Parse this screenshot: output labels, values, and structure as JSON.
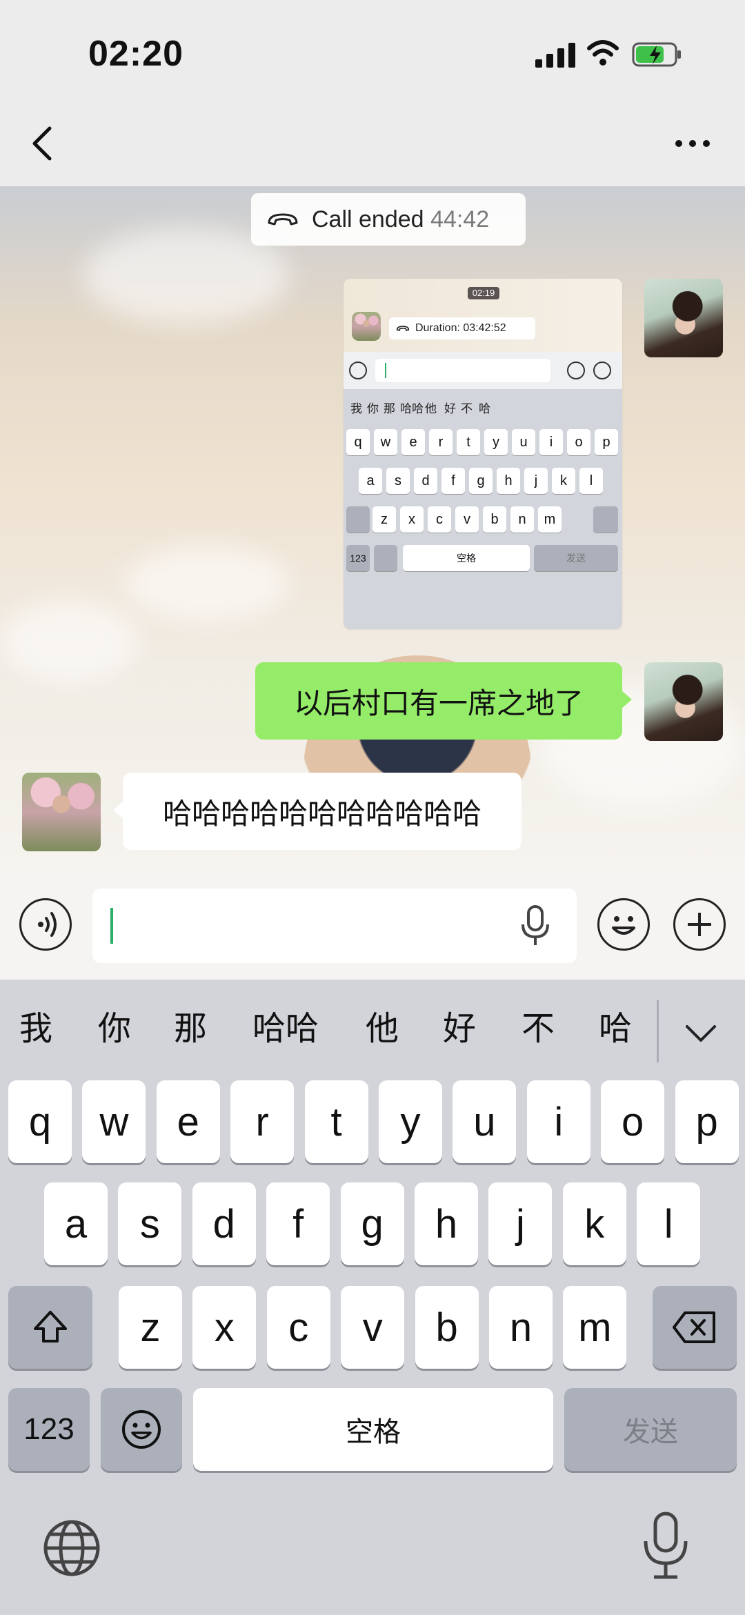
{
  "status_bar": {
    "time": "02:20"
  },
  "chat": {
    "call_label": "Call ended",
    "call_duration": "44:42",
    "messages": [
      {
        "from": "me",
        "type": "image"
      },
      {
        "from": "me",
        "type": "text",
        "text": "以后村口有一席之地了"
      },
      {
        "from": "other",
        "type": "text",
        "text": "哈哈哈哈哈哈哈哈哈哈哈"
      }
    ],
    "screenshot": {
      "time": "02:19",
      "call_text": "Duration: 03:42:52",
      "candidates": [
        "我",
        "你",
        "那",
        "哈哈",
        "他",
        "好",
        "不",
        "哈"
      ],
      "row1": [
        "q",
        "w",
        "e",
        "r",
        "t",
        "y",
        "u",
        "i",
        "o",
        "p"
      ],
      "row2": [
        "a",
        "s",
        "d",
        "f",
        "g",
        "h",
        "j",
        "k",
        "l"
      ],
      "row3": [
        "z",
        "x",
        "c",
        "v",
        "b",
        "n",
        "m"
      ],
      "num_label": "123",
      "space_label": "空格",
      "send_label": "发送"
    }
  },
  "keyboard": {
    "candidates": [
      "我",
      "你",
      "那",
      "哈哈",
      "他",
      "好",
      "不",
      "哈"
    ],
    "row1": [
      "q",
      "w",
      "e",
      "r",
      "t",
      "y",
      "u",
      "i",
      "o",
      "p"
    ],
    "row2": [
      "a",
      "s",
      "d",
      "f",
      "g",
      "h",
      "j",
      "k",
      "l"
    ],
    "row3": [
      "z",
      "x",
      "c",
      "v",
      "b",
      "n",
      "m"
    ],
    "num_label": "123",
    "space_label": "空格",
    "send_label": "发送"
  },
  "icons": {
    "back": "chevron-left-icon",
    "more": "ellipsis-icon",
    "voice": "voice-wave-icon",
    "emoji": "emoji-icon",
    "plus": "plus-circle-icon",
    "mic": "microphone-icon",
    "globe": "globe-icon",
    "shift": "shift-arrow-icon",
    "delete": "backspace-icon",
    "call": "phone-hangup-icon"
  },
  "colors": {
    "accent": "#95ec69",
    "cursor": "#2aae67"
  }
}
